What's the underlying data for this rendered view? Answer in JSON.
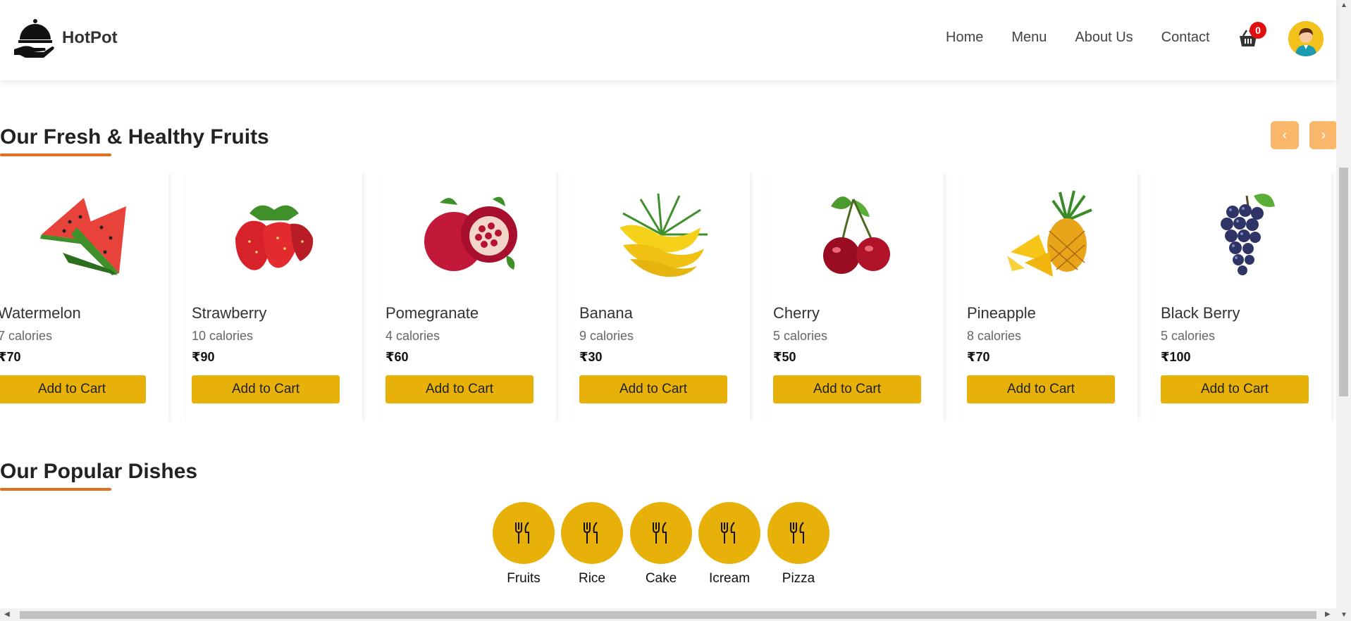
{
  "header": {
    "brand": "HotPot",
    "nav": [
      "Home",
      "Menu",
      "About Us",
      "Contact"
    ],
    "cart_count": "0"
  },
  "fruits_section": {
    "title": "Our Fresh & Healthy Fruits",
    "prev_label": "‹",
    "next_label": "›",
    "items": [
      {
        "name": "Watermelon",
        "calories": "7 calories",
        "price": "₹70",
        "button": "Add to Cart",
        "icon": "watermelon-icon"
      },
      {
        "name": "Strawberry",
        "calories": "10 calories",
        "price": "₹90",
        "button": "Add to Cart",
        "icon": "strawberry-icon"
      },
      {
        "name": "Pomegranate",
        "calories": "4 calories",
        "price": "₹60",
        "button": "Add to Cart",
        "icon": "pomegranate-icon"
      },
      {
        "name": "Banana",
        "calories": "9 calories",
        "price": "₹30",
        "button": "Add to Cart",
        "icon": "banana-icon"
      },
      {
        "name": "Cherry",
        "calories": "5 calories",
        "price": "₹50",
        "button": "Add to Cart",
        "icon": "cherry-icon"
      },
      {
        "name": "Pineapple",
        "calories": "8 calories",
        "price": "₹70",
        "button": "Add to Cart",
        "icon": "pineapple-icon"
      },
      {
        "name": "Black Berry",
        "calories": "5 calories",
        "price": "₹100",
        "button": "Add to Cart",
        "icon": "blackberry-icon"
      }
    ]
  },
  "dishes_section": {
    "title": "Our Popular Dishes",
    "items": [
      {
        "label": "Fruits",
        "icon": "fork-knife-icon"
      },
      {
        "label": "Rice",
        "icon": "fork-knife-icon"
      },
      {
        "label": "Cake",
        "icon": "fork-knife-icon"
      },
      {
        "label": "Icream",
        "icon": "fork-knife-icon"
      },
      {
        "label": "Pizza",
        "icon": "fork-knife-icon"
      }
    ]
  },
  "colors": {
    "accent": "#e8b10a",
    "underline": "#e07020",
    "arrow_button": "#f8b76b",
    "badge": "#e01010"
  }
}
